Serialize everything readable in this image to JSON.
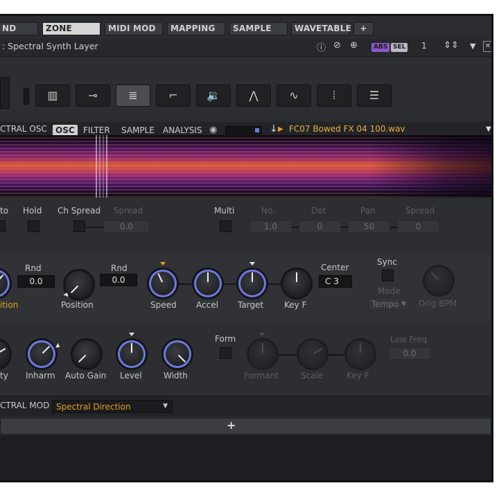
{
  "tabs": [
    {
      "label": "ND",
      "active": false
    },
    {
      "label": "ZONE",
      "active": true
    },
    {
      "label": "MIDI MOD",
      "active": false
    },
    {
      "label": "MAPPING",
      "active": false
    },
    {
      "label": "SAMPLE",
      "active": false
    },
    {
      "label": "WAVETABLE",
      "active": false
    },
    {
      "label": "+",
      "active": false
    }
  ],
  "titlebar": {
    "title": ": Spectral Synth Layer",
    "abs_label": "ABS",
    "sel_label": "SEL",
    "voice_number": "1",
    "icons": [
      "info-icon",
      "mute-icon",
      "target-icon",
      "updown-arrows-icon",
      "dropdown-icon",
      "close-icon"
    ]
  },
  "mode_buttons": [
    {
      "name": "keyboard",
      "glyph": "▥",
      "active": false
    },
    {
      "name": "plug",
      "glyph": "⊸",
      "active": false
    },
    {
      "name": "spectral",
      "glyph": "≣",
      "active": true
    },
    {
      "name": "filter",
      "glyph": "⌐",
      "active": false
    },
    {
      "name": "speaker",
      "glyph": "🔉",
      "active": false
    },
    {
      "name": "envelope",
      "glyph": "⋀",
      "active": false
    },
    {
      "name": "lfo",
      "glyph": "∿",
      "active": false
    },
    {
      "name": "steps",
      "glyph": "⦙",
      "active": false
    },
    {
      "name": "list",
      "glyph": "☰",
      "active": false
    }
  ],
  "osc_header": {
    "label": "CTRAL OSC",
    "subtabs": [
      {
        "label": "OSC",
        "active": true
      },
      {
        "label": "FILTER",
        "active": false
      },
      {
        "label": "SAMPLE",
        "active": false
      },
      {
        "label": "ANALYSIS",
        "active": false
      }
    ],
    "filename": "FC07 Bowed FX 04 100.wav"
  },
  "row1": {
    "to": "to",
    "hold": "Hold",
    "ch_spread": "Ch Spread",
    "spread": "Spread",
    "spread_value": "0.0",
    "multi": "Multi",
    "no": "No.",
    "no_value": "1.0",
    "det": "Det",
    "det_value": "0",
    "pan": "Pan",
    "pan_value": "50",
    "spread2": "Spread",
    "spread2_value": "0"
  },
  "row2": {
    "rnd1": "Rnd",
    "rnd1_value": "0.0",
    "position_partial": "ition",
    "position": "Position",
    "rnd2": "Rnd",
    "rnd2_value": "0.0",
    "speed": "Speed",
    "accel": "Accel",
    "target": "Target",
    "key_f": "Key F",
    "center": "Center",
    "center_value": "C 3",
    "sync": "Sync",
    "mode": "Mode",
    "mode_value": "Tempo",
    "orig_bpm": "Orig BPM"
  },
  "row3": {
    "ty": "ty",
    "inharm": "Inharm",
    "auto_gain": "Auto Gain",
    "level": "Level",
    "width": "Width",
    "form": "Form",
    "formant": "Formant",
    "scale": "Scale",
    "key_f": "Key F",
    "low_freq": "Low Freq",
    "low_freq_value": "0.0"
  },
  "mod": {
    "label": "CTRAL MOD",
    "value": "Spectral Direction",
    "add": "+"
  },
  "colors": {
    "accent_orange": "#e8a020",
    "ring_blue": "#6c7adf",
    "panel": "#2a2c2f"
  }
}
